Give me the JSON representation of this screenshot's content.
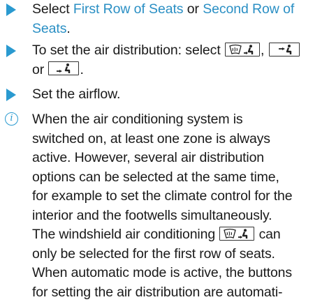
{
  "steps": [
    {
      "before": "Select ",
      "link1": "First Row of Seats",
      "middle": " or ",
      "link2": "Second Row of",
      "link2b": "Seats",
      "after": "."
    },
    {
      "before": "To set the air distribution: select",
      "sep1": ",",
      "or": "or",
      "end": ".",
      "icons": [
        "windshield-footwell-airflow-icon",
        "upper-body-airflow-icon",
        "footwell-airflow-icon"
      ]
    },
    {
      "text": "Set the airflow."
    }
  ],
  "note": {
    "icon_glyph": "i",
    "lines": [
      "When the air conditioning system is",
      "switched on, at least one zone is always",
      "active. However, several air distribution",
      "options can be selected at the same time,",
      "for example to set the climate control for the",
      "interior and the footwells simultaneously.",
      "The windshield air conditioning",
      "can",
      "only be selected for the first row of seats.",
      "When automatic mode is active, the buttons",
      "for setting the air distribution are automati-"
    ]
  },
  "colors": {
    "accent": "#2a9ad0",
    "link": "#2a8fc4",
    "text": "#1a1a1a"
  }
}
